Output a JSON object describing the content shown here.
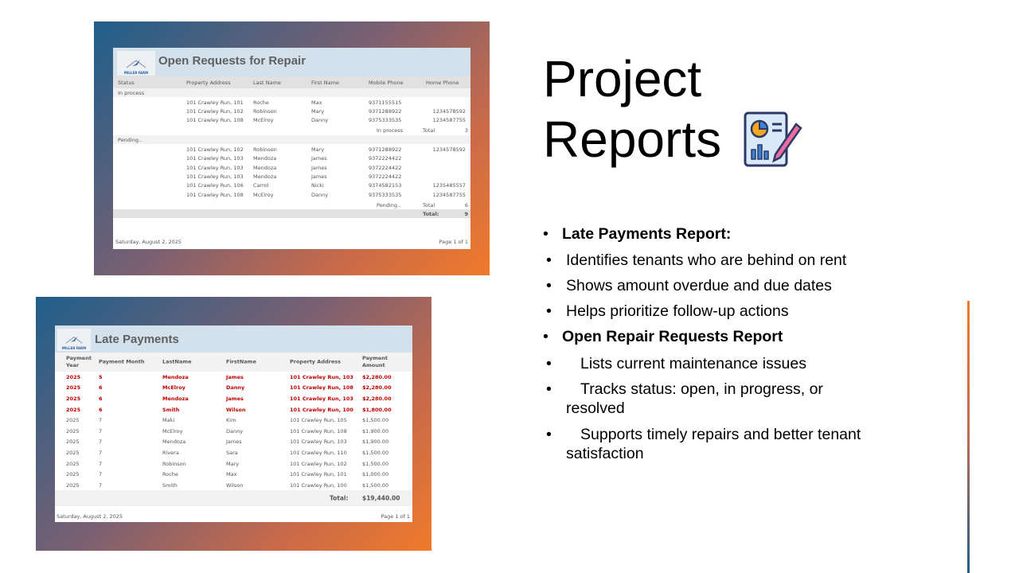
{
  "slide": {
    "title_line1": "Project",
    "title_line2": "Reports",
    "title_icon": "report-chart-pencil-icon"
  },
  "bullets": [
    {
      "text": "Late Payments Report:",
      "bold": true
    },
    {
      "text": "Identifies tenants who are behind on rent"
    },
    {
      "text": "Shows amount overdue and due dates"
    },
    {
      "text": "Helps prioritize follow-up actions"
    },
    {
      "text": "Open Repair Requests Report",
      "bold": true
    },
    {
      "text": "Lists current maintenance issues"
    },
    {
      "text": "Tracks status: open, in progress, or resolved"
    },
    {
      "text": "Supports timely repairs and better tenant satisfaction"
    }
  ],
  "repair": {
    "logo_text": "MILLER FARM",
    "title": "Open Requests for Repair",
    "columns": [
      "Status",
      "Property Address",
      "Last Name",
      "First Name",
      "Mobile Phone",
      "Home Phone"
    ],
    "groups": [
      {
        "status": "In process",
        "rows": [
          [
            "101 Crawley Run, 101",
            "Roche",
            "Max",
            "9371155515",
            ""
          ],
          [
            "101 Crawley Run, 102",
            "Robinson",
            "Mary",
            "9371288922",
            "1234578592"
          ],
          [
            "101 Crawley Run, 108",
            "McElroy",
            "Danny",
            "9375333535",
            "1234587755"
          ]
        ],
        "subtotal_label": "In process",
        "total_word": "Total",
        "count": "3"
      },
      {
        "status": "Pending..",
        "rows": [
          [
            "101 Crawley Run, 102",
            "Robinson",
            "Mary",
            "9371288922",
            "1234578592"
          ],
          [
            "101 Crawley Run, 103",
            "Mendoza",
            "James",
            "9372224422",
            ""
          ],
          [
            "101 Crawley Run, 103",
            "Mendoza",
            "James",
            "9372224422",
            ""
          ],
          [
            "101 Crawley Run, 103",
            "Mendoza",
            "James",
            "9372224422",
            ""
          ],
          [
            "101 Crawley Run, 106",
            "Carrol",
            "Nicki",
            "9374582153",
            "1235485557"
          ],
          [
            "101 Crawley Run, 108",
            "McElroy",
            "Danny",
            "9375333535",
            "1234587755"
          ]
        ],
        "subtotal_label": "Pending..",
        "total_word": "Total",
        "count": "6"
      }
    ],
    "grand_total_label": "Total:",
    "grand_total": "9",
    "date": "Saturday, August 2, 2025",
    "page": "Page 1 of 1"
  },
  "late": {
    "logo_text": "MILLER FARM",
    "title": "Late Payments",
    "columns": [
      "Payment Year",
      "Payment Month",
      "LastName",
      "FirstName",
      "Property Address",
      "Payment Amount"
    ],
    "rows": [
      [
        "2025",
        "5",
        "Mendoza",
        "James",
        "101 Crawley Run, 103",
        "$2,280.00",
        true
      ],
      [
        "2025",
        "6",
        "McElroy",
        "Danny",
        "101 Crawley Run, 108",
        "$2,280.00",
        true
      ],
      [
        "2025",
        "6",
        "Mendoza",
        "James",
        "101 Crawley Run, 103",
        "$2,280.00",
        true
      ],
      [
        "2025",
        "6",
        "Smith",
        "Wilson",
        "101 Crawley Run, 100",
        "$1,800.00",
        true
      ],
      [
        "2025",
        "7",
        "Maki",
        "Kim",
        "101 Crawley Run, 105",
        "$1,500.00",
        false
      ],
      [
        "2025",
        "7",
        "McElroy",
        "Danny",
        "101 Crawley Run, 108",
        "$1,900.00",
        false
      ],
      [
        "2025",
        "7",
        "Mendoza",
        "James",
        "101 Crawley Run, 103",
        "$1,900.00",
        false
      ],
      [
        "2025",
        "7",
        "Rivera",
        "Sara",
        "101 Crawley Run, 110",
        "$1,500.00",
        false
      ],
      [
        "2025",
        "7",
        "Robinson",
        "Mary",
        "101 Crawley Run, 102",
        "$1,500.00",
        false
      ],
      [
        "2025",
        "7",
        "Roche",
        "Max",
        "101 Crawley Run, 101",
        "$1,000.00",
        false
      ],
      [
        "2025",
        "7",
        "Smith",
        "Wilson",
        "101 Crawley Run, 100",
        "$1,500.00",
        false
      ]
    ],
    "total_label": "Total:",
    "total": "$19,440.00",
    "date": "Saturday, August 2, 2025",
    "page": "Page 1 of 1"
  },
  "colors": {
    "accent_orange": "#f07a2a",
    "accent_blue": "#1f5f8b",
    "overdue_red": "#c00000"
  }
}
